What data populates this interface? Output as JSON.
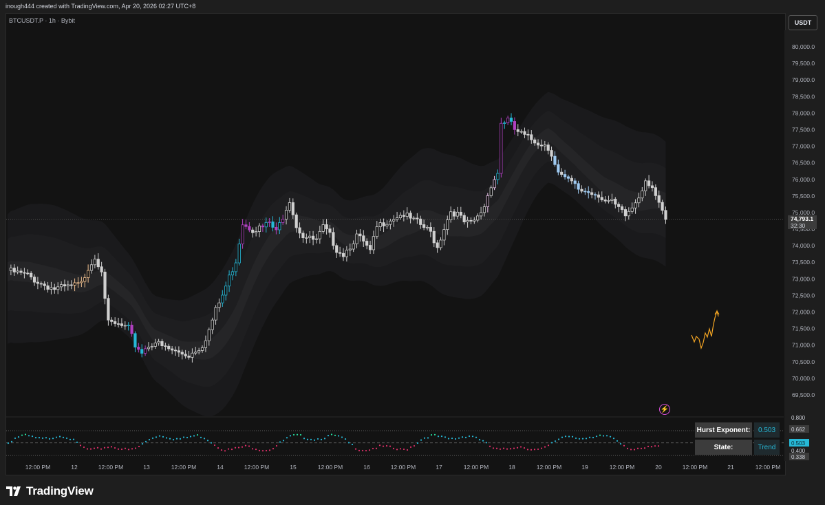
{
  "header": {
    "created_text": "inough444 created with TradingView.com, Apr 20, 2026 02:27 UTC+8"
  },
  "symbol_line": "BTCUSDT.P · 1h · Bybit",
  "currency_button": "USDT",
  "price_tag": {
    "price": "74,793.1",
    "countdown": "32:30"
  },
  "brand": {
    "name": "TradingView",
    "icon": "tradingview-logo-icon"
  },
  "indicator_table": {
    "rows": [
      {
        "label": "Hurst Exponent:",
        "value": "0.503"
      },
      {
        "label": "State:",
        "value": "Trend"
      }
    ]
  },
  "indicator_labels": [
    "0.800",
    "0.662",
    "0.503",
    "0.400",
    "0.338"
  ],
  "icons": {
    "alert": "lightning-bolt-icon"
  },
  "colors": {
    "background": "#131313",
    "candle_neutral": "#d0d0d0",
    "candle_bull": "#26b8d6",
    "candle_bear": "#b040c0",
    "candle_light_blue": "#9ec9f0",
    "candle_pink": "#f0c8f0",
    "candle_orange": "#f0c090",
    "band_fill": "#1c1c1e",
    "dot_up": "#26e0a0",
    "dot_mid": "#26b8d6",
    "dot_down": "#e0306a",
    "annotation": "#f5a623"
  },
  "chart_data": {
    "type": "candlestick",
    "title": "",
    "y_axis": {
      "labels": [
        "80,000.0",
        "79,500.0",
        "79,000.0",
        "78,500.0",
        "78,000.0",
        "77,500.0",
        "77,000.0",
        "76,500.0",
        "76,000.0",
        "75,500.0",
        "75,000.0",
        "74,500.0",
        "74,000.0",
        "73,500.0",
        "73,000.0",
        "72,500.0",
        "72,000.0",
        "71,500.0",
        "71,000.0",
        "70,500.0",
        "70,000.0",
        "69,500.0"
      ],
      "range": [
        69500,
        80300
      ]
    },
    "x_axis": {
      "labels": [
        "12:00 PM",
        "12",
        "12:00 PM",
        "13",
        "12:00 PM",
        "14",
        "12:00 PM",
        "15",
        "12:00 PM",
        "16",
        "12:00 PM",
        "17",
        "12:00 PM",
        "18",
        "12:00 PM",
        "19",
        "12:00 PM",
        "20",
        "12:00 PM",
        "21",
        "12:00 PM"
      ]
    },
    "last_price": 74793.1,
    "close_path": [
      [
        0,
        73250
      ],
      [
        6,
        73100
      ],
      [
        10,
        72850
      ],
      [
        14,
        72700
      ],
      [
        18,
        72750
      ],
      [
        22,
        72850
      ],
      [
        24,
        73350
      ],
      [
        26,
        73650
      ],
      [
        28,
        73300
      ],
      [
        30,
        71650
      ],
      [
        33,
        71600
      ],
      [
        36,
        71500
      ],
      [
        38,
        71000
      ],
      [
        40,
        70800
      ],
      [
        42,
        71000
      ],
      [
        44,
        71100
      ],
      [
        46,
        70950
      ],
      [
        50,
        70800
      ],
      [
        54,
        70700
      ],
      [
        58,
        71000
      ],
      [
        60,
        71450
      ],
      [
        62,
        72050
      ],
      [
        64,
        72500
      ],
      [
        66,
        73050
      ],
      [
        68,
        73550
      ],
      [
        70,
        74700
      ],
      [
        73,
        74500
      ],
      [
        76,
        74550
      ],
      [
        78,
        74700
      ],
      [
        80,
        74400
      ],
      [
        82,
        74900
      ],
      [
        84,
        75400
      ],
      [
        86,
        74600
      ],
      [
        88,
        74300
      ],
      [
        90,
        74200
      ],
      [
        92,
        74150
      ],
      [
        94,
        74550
      ],
      [
        96,
        74300
      ],
      [
        98,
        73900
      ],
      [
        100,
        73750
      ],
      [
        102,
        74000
      ],
      [
        104,
        74300
      ],
      [
        106,
        74100
      ],
      [
        108,
        73800
      ],
      [
        110,
        74550
      ],
      [
        112,
        74700
      ],
      [
        114,
        74800
      ],
      [
        116,
        74900
      ],
      [
        118,
        74950
      ],
      [
        120,
        74800
      ],
      [
        122,
        74700
      ],
      [
        124,
        74550
      ],
      [
        126,
        74400
      ],
      [
        128,
        73950
      ],
      [
        130,
        74550
      ],
      [
        132,
        75050
      ],
      [
        134,
        74950
      ],
      [
        136,
        74700
      ],
      [
        138,
        74650
      ],
      [
        140,
        74850
      ],
      [
        142,
        75200
      ],
      [
        144,
        75850
      ],
      [
        146,
        76200
      ],
      [
        147,
        77700
      ],
      [
        149,
        77800
      ],
      [
        151,
        77500
      ],
      [
        154,
        77300
      ],
      [
        157,
        77150
      ],
      [
        160,
        77050
      ],
      [
        162,
        76800
      ],
      [
        164,
        76200
      ],
      [
        166,
        76000
      ],
      [
        168,
        75900
      ],
      [
        170,
        75700
      ],
      [
        172,
        75650
      ],
      [
        174,
        75600
      ],
      [
        176,
        75550
      ],
      [
        178,
        75350
      ],
      [
        180,
        75300
      ],
      [
        182,
        75100
      ],
      [
        184,
        74900
      ],
      [
        186,
        75150
      ],
      [
        188,
        75500
      ],
      [
        190,
        76000
      ],
      [
        192,
        75800
      ],
      [
        194,
        75200
      ],
      [
        196,
        74793
      ]
    ],
    "indicator": {
      "name": "Hurst Exponent",
      "levels": [
        0.338,
        0.503,
        0.662
      ],
      "current": 0.503
    }
  }
}
